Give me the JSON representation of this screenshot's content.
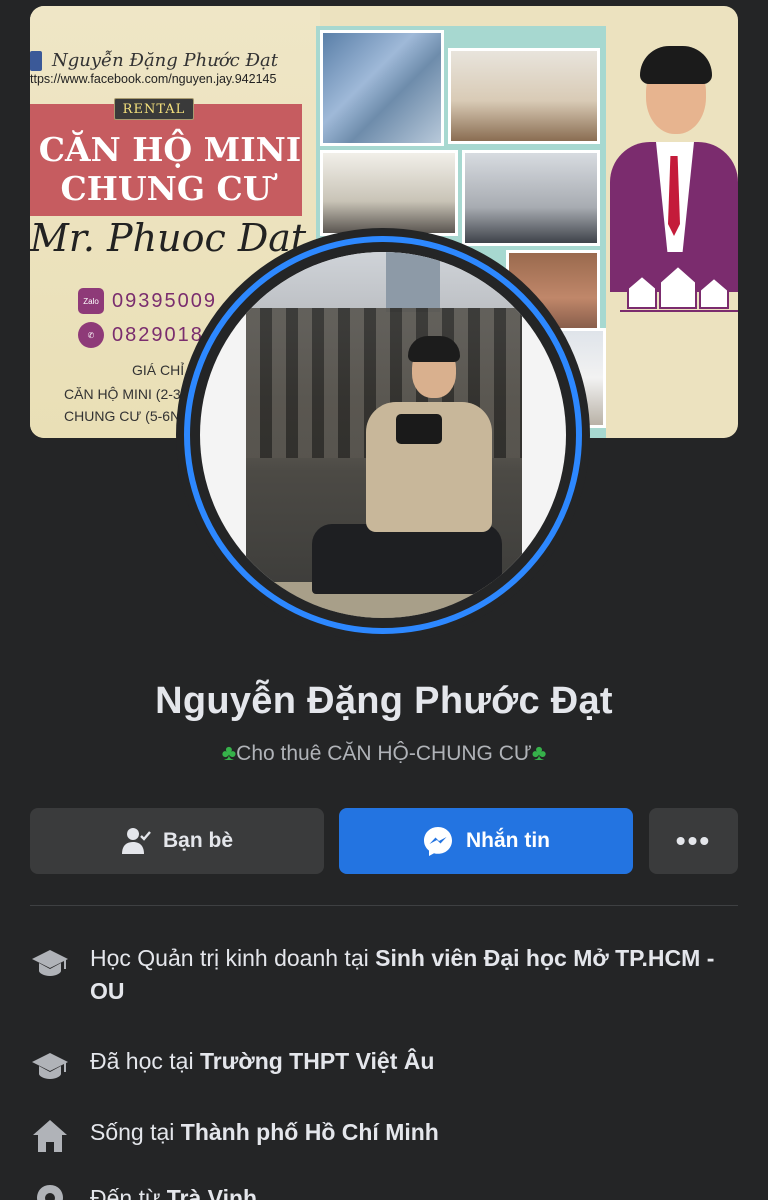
{
  "cover": {
    "fb_name": "Nguyễn Đặng Phước Đạt",
    "fb_url": "ttps://www.facebook.com/nguyen.jay.942145",
    "rental_badge": "RENTAL",
    "headline_1": "CĂN HỘ MINI",
    "headline_2": "CHUNG CƯ",
    "signature": "Mr. Phuoc Dat",
    "zalo_label": "Zalo",
    "phone_1": "09395009",
    "phone_2": "0829018",
    "price_1": "GIÁ CHỈ",
    "price_2": "CĂN HỘ MINI (2-3",
    "price_3": "CHUNG CƯ (5-6N"
  },
  "profile": {
    "name": "Nguyễn Đặng Phước Đạt",
    "bio_prefix_icon": "four-leaf-clover",
    "bio": "Cho thuê CĂN HỘ-CHUNG CƯ",
    "ring_color": "#2d88ff"
  },
  "actions": {
    "friends_label": "Bạn bè",
    "friends_icon": "friend-check-icon",
    "message_label": "Nhắn tin",
    "message_icon": "messenger-icon",
    "more_label": "•••",
    "message_color": "#2374e1"
  },
  "info": [
    {
      "icon": "graduation-cap-icon",
      "prefix": "Học Quản trị kinh doanh tại ",
      "value": "Sinh viên Đại học Mở TP.HCM - OU"
    },
    {
      "icon": "graduation-cap-icon",
      "prefix": "Đã học tại ",
      "value": "Trường THPT Việt Âu"
    },
    {
      "icon": "home-icon",
      "prefix": "Sống tại ",
      "value": "Thành phố Hồ Chí Minh"
    },
    {
      "icon": "location-pin-icon",
      "prefix": "Đến từ ",
      "value": "Trà Vinh"
    }
  ]
}
